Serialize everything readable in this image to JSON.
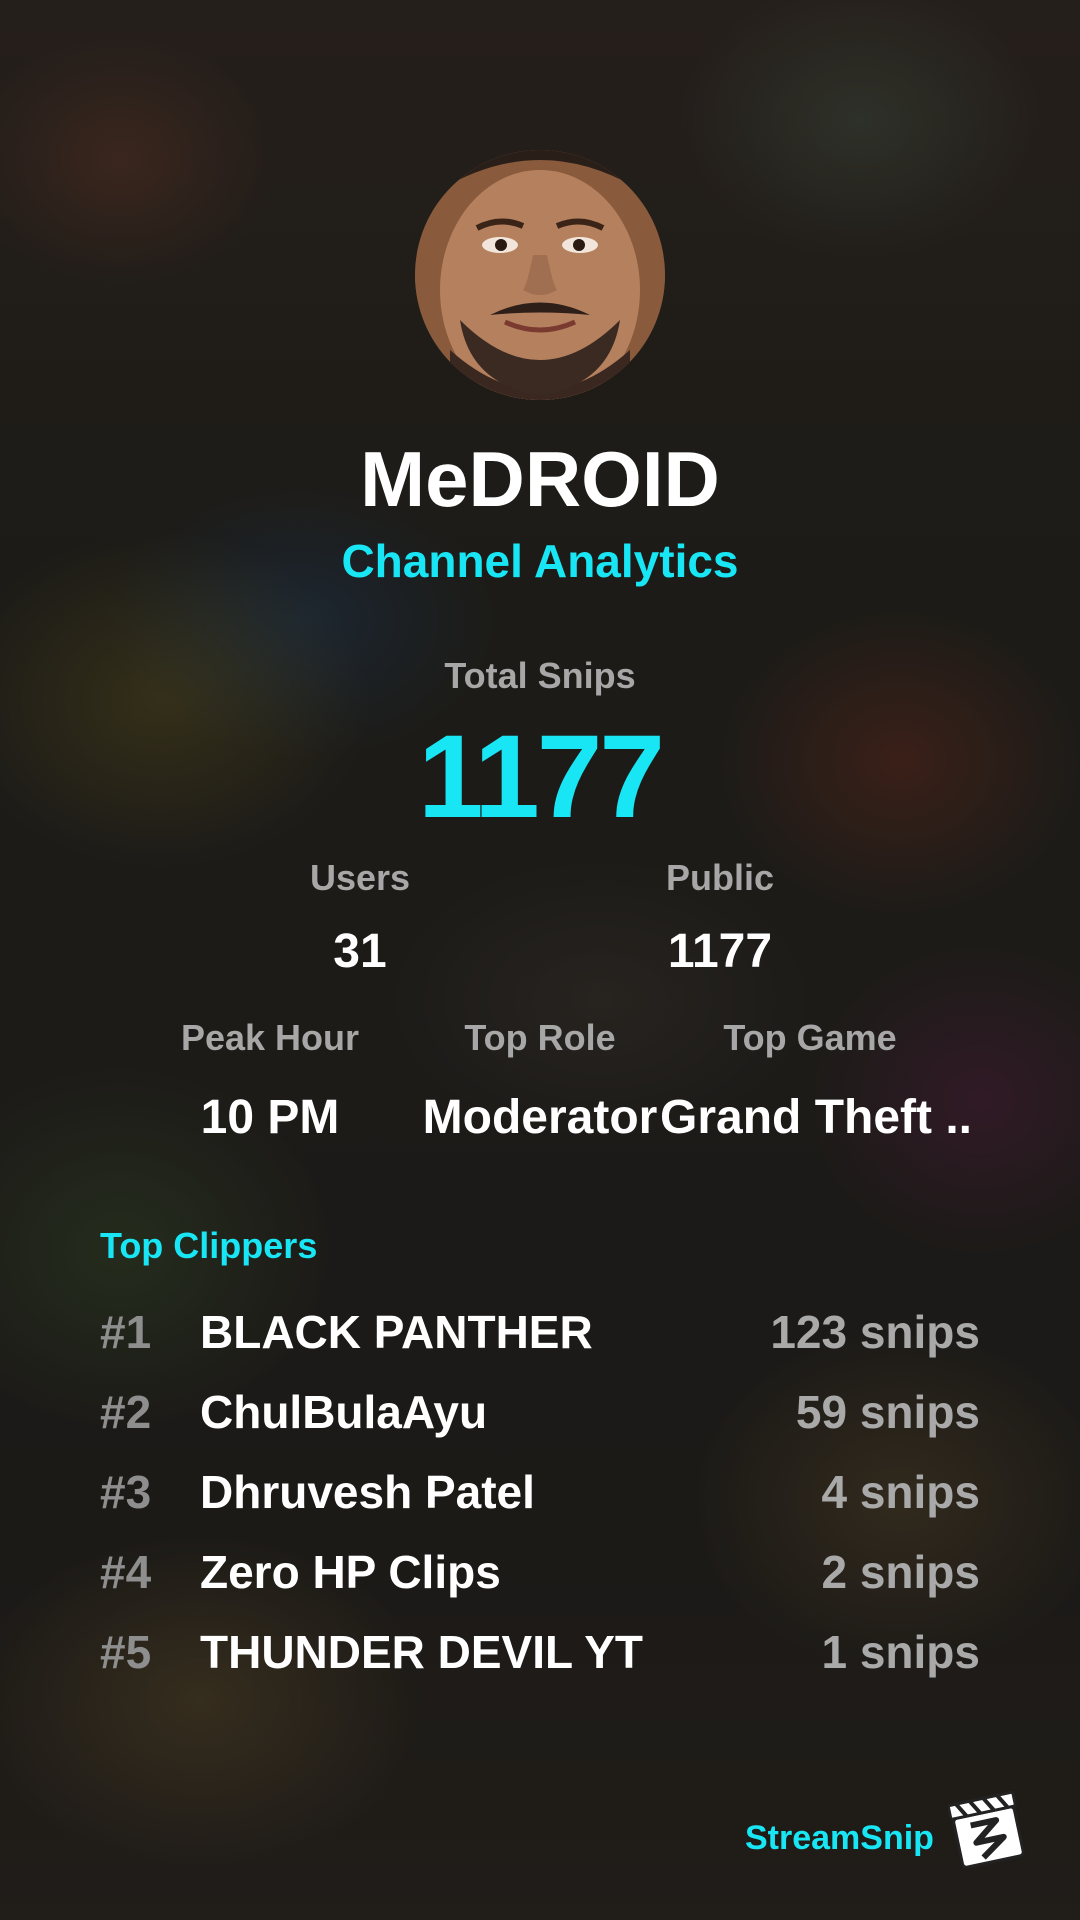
{
  "channel": {
    "name": "MeDROID",
    "subtitle": "Channel Analytics"
  },
  "totals": {
    "label": "Total Snips",
    "value": "1177"
  },
  "stats": {
    "users": {
      "label": "Users",
      "value": "31"
    },
    "public": {
      "label": "Public",
      "value": "1177"
    },
    "peak_hour": {
      "label": "Peak Hour",
      "value": "10 PM"
    },
    "top_role": {
      "label": "Top Role",
      "value": "Moderator"
    },
    "top_game": {
      "label": "Top Game",
      "value": "Grand Theft .."
    }
  },
  "top_clippers": {
    "title": "Top Clippers",
    "rows": [
      {
        "rank": "#1",
        "name": "BLACK PANTHER",
        "count": "123 snips"
      },
      {
        "rank": "#2",
        "name": "ChulBulaAyu",
        "count": "59 snips"
      },
      {
        "rank": "#3",
        "name": "Dhruvesh Patel",
        "count": "4 snips"
      },
      {
        "rank": "#4",
        "name": "Zero HP Clips",
        "count": "2 snips"
      },
      {
        "rank": "#5",
        "name": "THUNDER DEVIL YT",
        "count": "1 snips"
      }
    ]
  },
  "brand": {
    "name": "StreamSnip",
    "logo_icon": "clapperboard-logo-icon"
  },
  "colors": {
    "accent": "#19e6f4",
    "label": "#a7a7a7",
    "text": "#ffffff"
  }
}
